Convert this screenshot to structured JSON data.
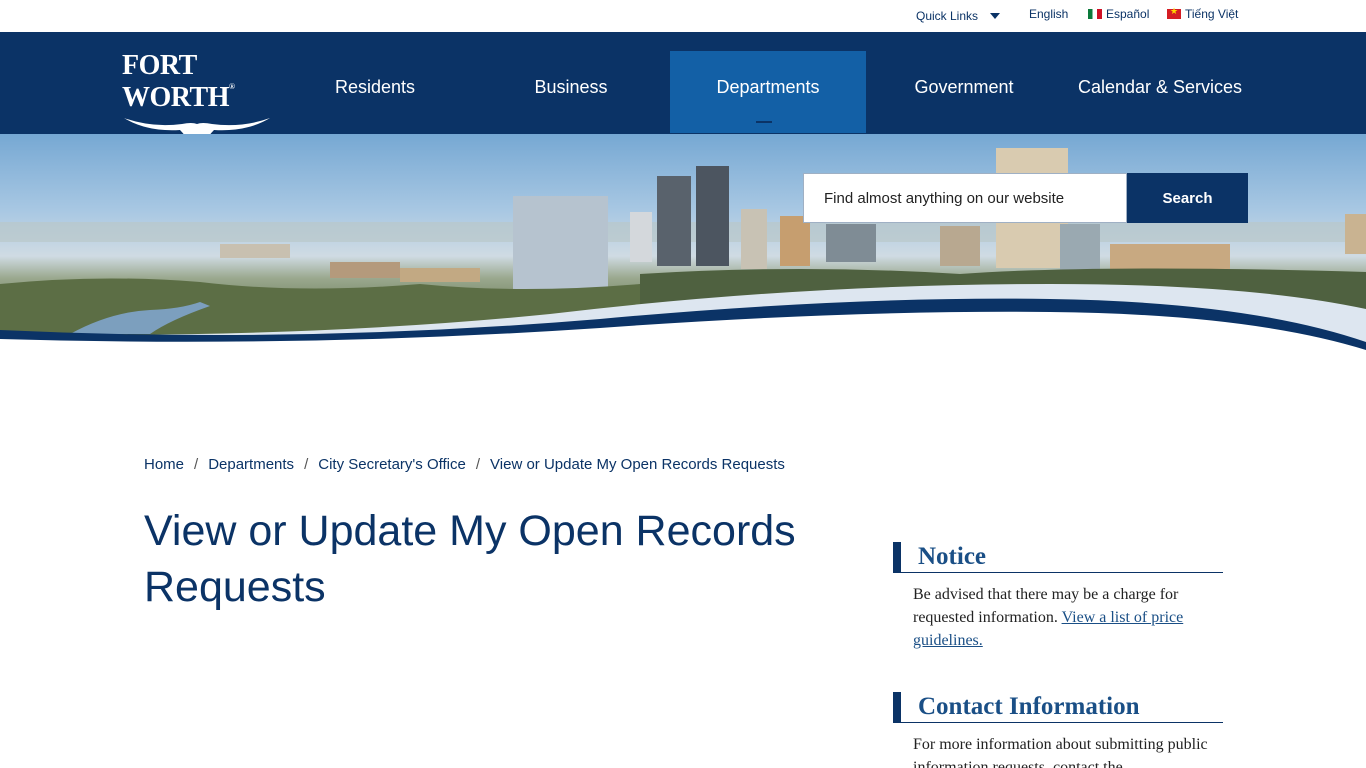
{
  "utility": {
    "quick_links": "Quick Links",
    "languages": [
      {
        "label": "English"
      },
      {
        "label": "Español"
      },
      {
        "label": "Tiếng Việt"
      }
    ]
  },
  "brand": {
    "logo_text": "FORT WORTH",
    "logo_mark": "®"
  },
  "nav": {
    "items": [
      {
        "label": "Residents"
      },
      {
        "label": "Business"
      },
      {
        "label": "Departments",
        "active": true
      },
      {
        "label": "Government"
      },
      {
        "label": "Calendar & Services"
      }
    ]
  },
  "search": {
    "placeholder": "Find almost anything on our website",
    "button": "Search"
  },
  "breadcrumb": {
    "items": [
      "Home",
      "Departments",
      "City Secretary's Office"
    ],
    "separator": "/",
    "current": "View or Update My Open Records Requests"
  },
  "page": {
    "title": "View or Update My Open Records Requests"
  },
  "sidebar": {
    "notice": {
      "heading": "Notice",
      "text": "Be advised that there may be a charge for requested information. ",
      "link": "View a list of price guidelines."
    },
    "contact": {
      "heading": "Contact Information",
      "text": "For more information about submitting public information requests, contact the"
    }
  },
  "colors": {
    "brand_navy": "#0b3366",
    "active_blue": "#1360a6",
    "heading_blue": "#1a4f86"
  }
}
